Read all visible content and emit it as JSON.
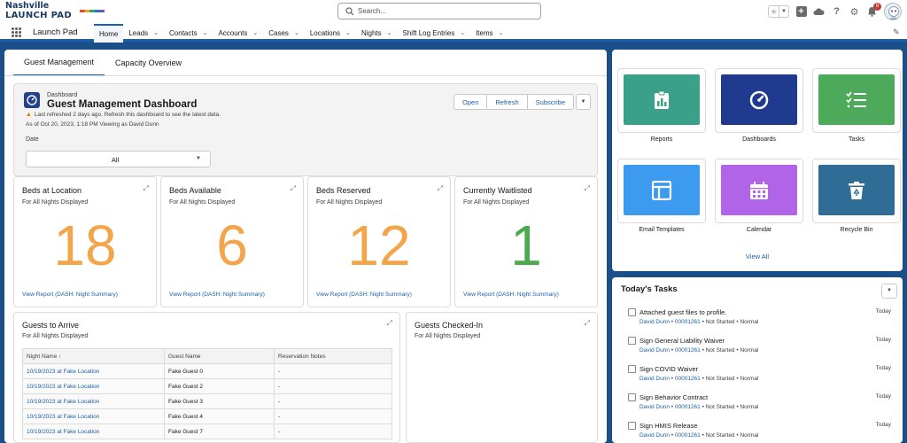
{
  "brand": {
    "line1": "Nashville",
    "line2": "LAUNCH PAD",
    "tag": ""
  },
  "header": {
    "search_placeholder": "Search...",
    "notification_count": "8"
  },
  "nav": {
    "app_name": "Launch Pad",
    "items": [
      "Home",
      "Leads",
      "Contacts",
      "Accounts",
      "Cases",
      "Locations",
      "Nights",
      "Shift Log Entries",
      "Items"
    ]
  },
  "tabs": [
    "Guest Management",
    "Capacity Overview"
  ],
  "dashboard": {
    "kind": "Dashboard",
    "title": "Guest Management Dashboard",
    "warning": "Last refreshed 2 days ago. Refresh this dashboard to see the latest data.",
    "as_of": "As of Oct 20, 2023, 1:18 PM Viewing as David Dunn",
    "filter_label": "Date",
    "filter_value": "All",
    "buttons": [
      "Open",
      "Refresh",
      "Subscribe"
    ]
  },
  "metrics": [
    {
      "title": "Beds at Location",
      "subtitle": "For All Nights Displayed",
      "value": "18",
      "link": "View Report (DASH: Night Summary)"
    },
    {
      "title": "Beds Available",
      "subtitle": "For All Nights Displayed",
      "value": "6",
      "link": "View Report (DASH: Night Summary)"
    },
    {
      "title": "Beds Reserved",
      "subtitle": "For All Nights Displayed",
      "value": "12",
      "link": "View Report (DASH: Night Summary)"
    },
    {
      "title": "Currently Waitlisted",
      "subtitle": "For All Nights Displayed",
      "value": "1",
      "link": "View Report (DASH: Night Summary)"
    }
  ],
  "arrive": {
    "title": "Guests to Arrive",
    "subtitle": "For All Nights Displayed",
    "columns": [
      "Night Name ↑",
      "Guest Name",
      "Reservation Notes"
    ],
    "rows": [
      [
        "10/19/2023 at Fake Location",
        "Fake Guest 0",
        "-"
      ],
      [
        "10/19/2023 at Fake Location",
        "Fake Guest 2",
        "-"
      ],
      [
        "10/19/2023 at Fake Location",
        "Fake Guest 3",
        "-"
      ],
      [
        "10/19/2023 at Fake Location",
        "Fake Guest 4",
        "-"
      ],
      [
        "10/19/2023 at Fake Location",
        "Fake Guest 7",
        "-"
      ]
    ]
  },
  "checked_in": {
    "title": "Guests Checked-In",
    "subtitle": "For All Nights Displayed"
  },
  "launcher": {
    "tiles": [
      {
        "label": "Reports",
        "color": "#3aa08a",
        "icon": "clipboard-chart-icon"
      },
      {
        "label": "Dashboards",
        "color": "#1f3a8f",
        "icon": "gauge-icon"
      },
      {
        "label": "Tasks",
        "color": "#4eaa5b",
        "icon": "checklist-icon"
      },
      {
        "label": "Email Templates",
        "color": "#3d9bef",
        "icon": "template-icon"
      },
      {
        "label": "Calendar",
        "color": "#b164e8",
        "icon": "calendar-icon"
      },
      {
        "label": "Recycle Bin",
        "color": "#2f6d96",
        "icon": "recycle-bin-icon"
      }
    ],
    "view_all": "View All"
  },
  "tasks": {
    "title": "Today's Tasks",
    "items": [
      {
        "title": "Attached guest files to profile.",
        "due": "Today",
        "owner": "David Dunn",
        "record": "00001261",
        "status": "Not Started",
        "priority": "Normal"
      },
      {
        "title": "Sign General Liability Waiver",
        "due": "Today",
        "owner": "David Dunn",
        "record": "00001261",
        "status": "Not Started",
        "priority": "Normal"
      },
      {
        "title": "Sign COVID Waiver",
        "due": "Today",
        "owner": "David Dunn",
        "record": "00001261",
        "status": "Not Started",
        "priority": "Normal"
      },
      {
        "title": "Sign Behavior Contract",
        "due": "Today",
        "owner": "David Dunn",
        "record": "00001261",
        "status": "Not Started",
        "priority": "Normal"
      },
      {
        "title": "Sign HMIS Release",
        "due": "Today",
        "owner": "David Dunn",
        "record": "00001261",
        "status": "Not Started",
        "priority": "Normal"
      }
    ]
  },
  "colors": {
    "brand_blue": "#1b5fa8",
    "metric_orange": "#f2a54a",
    "metric_green": "#4caa4c"
  }
}
